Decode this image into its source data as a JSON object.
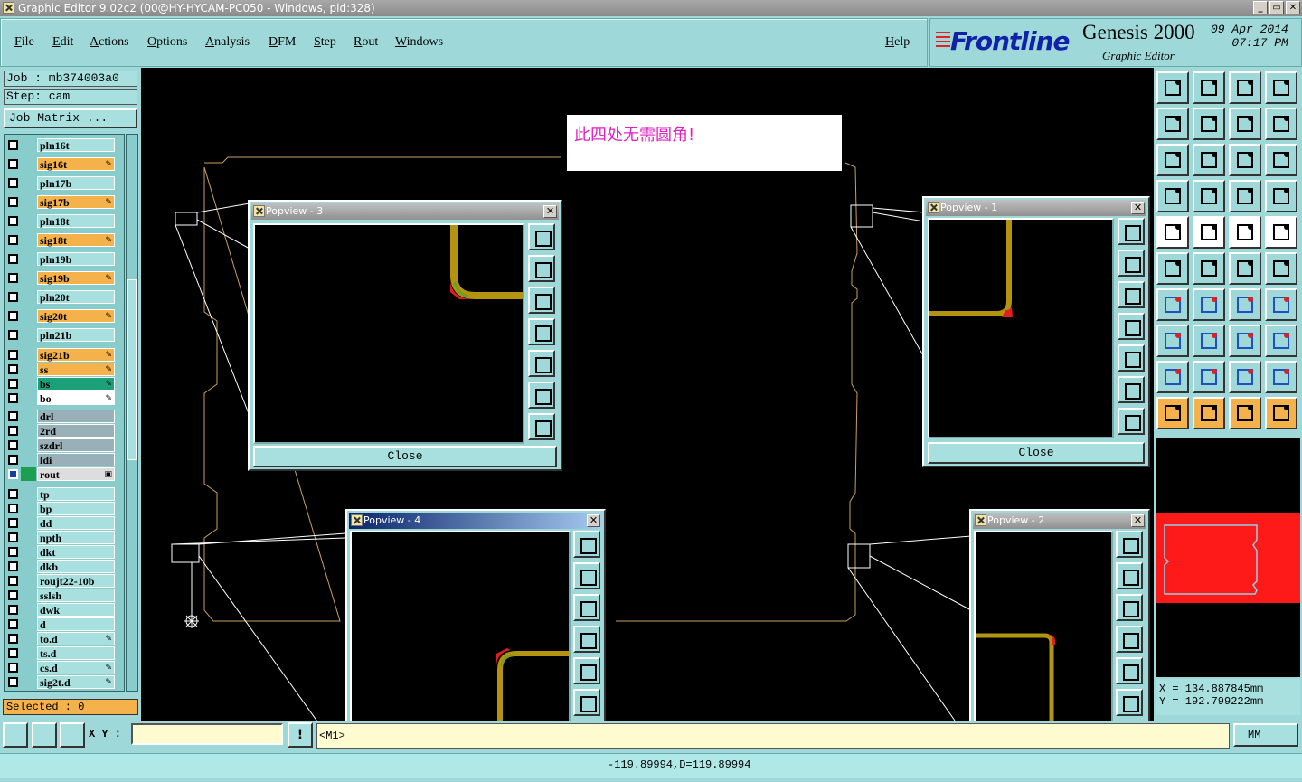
{
  "window": {
    "title": "Graphic Editor 9.02c2 (00@HY-HYCAM-PC050 - Windows, pid:328)",
    "min": "_",
    "max": "▭",
    "close": "✕"
  },
  "menu": [
    "File",
    "Edit",
    "Actions",
    "Options",
    "Analysis",
    "DFM",
    "Step",
    "Rout",
    "Windows"
  ],
  "help": "Help",
  "brand": {
    "logo": "Frontline",
    "product": "Genesis 2000",
    "subtitle": "Graphic Editor",
    "date": "09 Apr 2014",
    "time": "07:17 PM"
  },
  "job": {
    "job": "Job : mb374003a0",
    "step": "Step: cam",
    "matrix": "Job Matrix ..."
  },
  "layers": [
    {
      "name": "pln16t",
      "color": "#a8e0e0",
      "flag": ""
    },
    {
      "name": "sig16t",
      "color": "#f6b24a",
      "flag": "✎"
    },
    {
      "name": "pln17b",
      "color": "#a8e0e0",
      "flag": ""
    },
    {
      "name": "sig17b",
      "color": "#f6b24a",
      "flag": "✎"
    },
    {
      "name": "pln18t",
      "color": "#a8e0e0",
      "flag": ""
    },
    {
      "name": "sig18t",
      "color": "#f6b24a",
      "flag": "✎"
    },
    {
      "name": "pln19b",
      "color": "#a8e0e0",
      "flag": ""
    },
    {
      "name": "sig19b",
      "color": "#f6b24a",
      "flag": "✎"
    },
    {
      "name": "pln20t",
      "color": "#a8e0e0",
      "flag": ""
    },
    {
      "name": "sig20t",
      "color": "#f6b24a",
      "flag": "✎"
    },
    {
      "name": "pln21b",
      "color": "#a8e0e0",
      "flag": ""
    },
    {
      "name": "sig21b",
      "color": "#f6b24a",
      "flag": "✎"
    },
    {
      "name": "ss",
      "color": "#f6b24a",
      "flag": "✎"
    },
    {
      "name": "bs",
      "color": "#1ca07a",
      "flag": "✎"
    },
    {
      "name": "bo",
      "color": "#ffffff",
      "flag": "✎"
    },
    {
      "name": "drl",
      "color": "#9ab0b8",
      "flag": ""
    },
    {
      "name": "2rd",
      "color": "#9ab0b8",
      "flag": ""
    },
    {
      "name": "szdrl",
      "color": "#9ab0b8",
      "flag": ""
    },
    {
      "name": "ldi",
      "color": "#9ab0b8",
      "flag": ""
    },
    {
      "name": "rout",
      "color": "#dddddd",
      "flag": "▣"
    },
    {
      "name": "tp",
      "color": "#a8e0e0",
      "flag": ""
    },
    {
      "name": "bp",
      "color": "#a8e0e0",
      "flag": ""
    },
    {
      "name": "dd",
      "color": "#a8e0e0",
      "flag": ""
    },
    {
      "name": "npth",
      "color": "#a8e0e0",
      "flag": ""
    },
    {
      "name": "dkt",
      "color": "#a8e0e0",
      "flag": ""
    },
    {
      "name": "dkb",
      "color": "#a8e0e0",
      "flag": ""
    },
    {
      "name": "roujt22-10b",
      "color": "#a8e0e0",
      "flag": ""
    },
    {
      "name": "sslsh",
      "color": "#a8e0e0",
      "flag": ""
    },
    {
      "name": "dwk",
      "color": "#a8e0e0",
      "flag": ""
    },
    {
      "name": "d",
      "color": "#a8e0e0",
      "flag": ""
    },
    {
      "name": "to.d",
      "color": "#a8e0e0",
      "flag": "✎"
    },
    {
      "name": "ts.d",
      "color": "#a8e0e0",
      "flag": ""
    },
    {
      "name": "cs.d",
      "color": "#a8e0e0",
      "flag": "✎"
    },
    {
      "name": "sig2t.d",
      "color": "#a8e0e0",
      "flag": "✎"
    }
  ],
  "selected": "Selected : 0",
  "note": "此四处无需圆角!",
  "popups": {
    "p3": "Popview - 3",
    "p1": "Popview - 1",
    "p4": "Popview - 4",
    "p2": "Popview - 2",
    "close": "Close"
  },
  "bottom": {
    "xy": "X Y :",
    "m1": "<M1>",
    "status": "-119.89994,D=119.89994",
    "units": "MM"
  },
  "coords": {
    "x": "X  =  134.887845mm",
    "y": "Y  =  192.799222mm"
  },
  "colors": {
    "trace": "#b39410",
    "highlight": "#e02020",
    "outline": "#c8a060"
  }
}
